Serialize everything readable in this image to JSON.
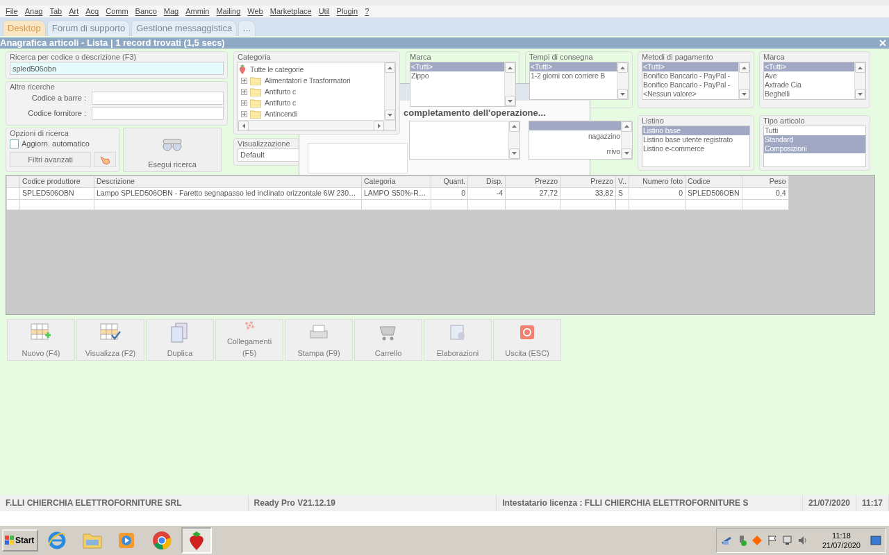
{
  "menu": [
    "File",
    "Anag",
    "Tab",
    "Art",
    "Acq",
    "Comm",
    "Banco",
    "Mag",
    "Ammin",
    "Mailing",
    "Web",
    "Marketplace",
    "Util",
    "Plugin",
    "?"
  ],
  "tabs": [
    {
      "label": "Desktop",
      "selected": true
    },
    {
      "label": "Forum di supporto",
      "selected": false
    },
    {
      "label": "Gestione messaggistica",
      "selected": false
    },
    {
      "label": "...",
      "selected": false
    }
  ],
  "panel_title": "Anagrafica articoli  - Lista | 1 record trovati (1,5 secs)",
  "search": {
    "label": "Ricerca per codice o descrizione (F3)",
    "value": "spled506obn"
  },
  "other_searches": {
    "label": "Altre ricerche",
    "fields": [
      {
        "label": "Codice a barre :"
      },
      {
        "label": "Codice fornitore :"
      }
    ]
  },
  "search_options": {
    "label": "Opzioni di ricerca",
    "auto_update": {
      "label": "Aggiorn. automatico",
      "checked": false
    },
    "advanced_filters": "Filtri avanzati"
  },
  "run_search": "Esegui ricerca",
  "category": {
    "label": "Categoria",
    "root": "Tutte le categorie",
    "items": [
      {
        "label": "Alimentatori e Trasformatori",
        "expanded": false
      },
      {
        "label": "Antifurto c",
        "expanded": false
      },
      {
        "label": "Antifurto c",
        "expanded": false
      },
      {
        "label": "Antincendi",
        "expanded": false
      }
    ]
  },
  "view": {
    "label": "Visualizzazione",
    "value": "Default"
  },
  "filters_top": [
    {
      "label": "Marca",
      "items": [
        {
          "label": "<Tutti>",
          "selected": true
        },
        {
          "label": "Zippo",
          "selected": false
        }
      ]
    },
    {
      "label": "Tempi di consegna",
      "items": [
        {
          "label": "<Tutti>",
          "selected": true
        },
        {
          "label": "1-2 giorni con corriere B",
          "selected": false
        }
      ]
    },
    {
      "label": "Metodi di pagamento",
      "items": [
        {
          "label": "<Tutti>",
          "selected": true
        },
        {
          "label": "Bonifico Bancario - PayPal -",
          "selected": false
        },
        {
          "label": "Bonifico Bancario - PayPal -",
          "selected": false
        },
        {
          "label": "<Nessun valore>",
          "selected": false
        }
      ]
    },
    {
      "label": "Marca",
      "items": [
        {
          "label": "<Tutti>",
          "selected": true
        },
        {
          "label": "Ave",
          "selected": false
        },
        {
          "label": "Axtrade Cia",
          "selected": false
        },
        {
          "label": "Beghelli",
          "selected": false
        }
      ]
    }
  ],
  "covered_list": {
    "items": [
      {
        "label": "nagazzino",
        "selected": false
      },
      {
        "label": "rrivo",
        "selected": false
      }
    ]
  },
  "filters_bottom": [
    {
      "label": "Listino",
      "items": [
        {
          "label": "Listino base",
          "selected": true
        },
        {
          "label": "Listino base utente registrato",
          "selected": false
        },
        {
          "label": "Listino e-commerce",
          "selected": false
        }
      ]
    },
    {
      "label": "Tipo articolo",
      "items": [
        {
          "label": "Tutti",
          "selected": false
        },
        {
          "label": "Standard",
          "selected": true
        },
        {
          "label": "Composizioni",
          "selected": true
        }
      ]
    }
  ],
  "dialog": {
    "message": "completamento dell'operazione..."
  },
  "table": {
    "columns": [
      {
        "label": "Codice produttore",
        "numeric": false
      },
      {
        "label": "Descrizione",
        "numeric": false
      },
      {
        "label": "Categoria",
        "numeric": false
      },
      {
        "label": "Quant.",
        "numeric": true
      },
      {
        "label": "Disp.",
        "numeric": true
      },
      {
        "label": "Prezzo",
        "numeric": true
      },
      {
        "label": "Prezzo",
        "numeric": true
      },
      {
        "label": "V..",
        "numeric": false
      },
      {
        "label": "Numero foto",
        "numeric": true
      },
      {
        "label": "Codice",
        "numeric": false
      },
      {
        "label": "Peso",
        "numeric": true
      }
    ],
    "rows": [
      [
        "SPLED506OBN",
        "Lampo SPLED506OBN - Faretto segnapasso led inclinato orizzontale 6W 230…",
        "LAMPO S50%-R…",
        "0",
        "-4",
        "27,72",
        "33,82",
        "S",
        "0",
        "SPLED506OBN",
        "0,4"
      ]
    ]
  },
  "actions": [
    {
      "label": "Nuovo (F4)",
      "kind": "new"
    },
    {
      "label": "Visualizza (F2)",
      "kind": "view"
    },
    {
      "label": "Duplica",
      "kind": "copy"
    },
    {
      "label": "Collegamenti (F5)",
      "kind": "links"
    },
    {
      "label": "Stampa (F9)",
      "kind": "print"
    },
    {
      "label": "Carrello",
      "kind": "cart"
    },
    {
      "label": "Elaborazioni",
      "kind": "process"
    },
    {
      "label": "Uscita (ESC)",
      "kind": "exit"
    }
  ],
  "status_bar": [
    "F.LLI CHIERCHIA ELETTROFORNITURE SRL",
    "Ready Pro V21.12.19",
    "Intestatario licenza : FLLI CHIERCHIA ELETTROFORNITURE S",
    "21/07/2020",
    "11:17"
  ],
  "taskbar": {
    "start": "Start",
    "apps": [
      {
        "kind": "ie",
        "selected": false
      },
      {
        "kind": "folder",
        "selected": false
      },
      {
        "kind": "media",
        "selected": false
      },
      {
        "kind": "chrome",
        "selected": false
      },
      {
        "kind": "strawberry",
        "selected": true
      }
    ],
    "time": "11:18",
    "date": "21/07/2020"
  }
}
